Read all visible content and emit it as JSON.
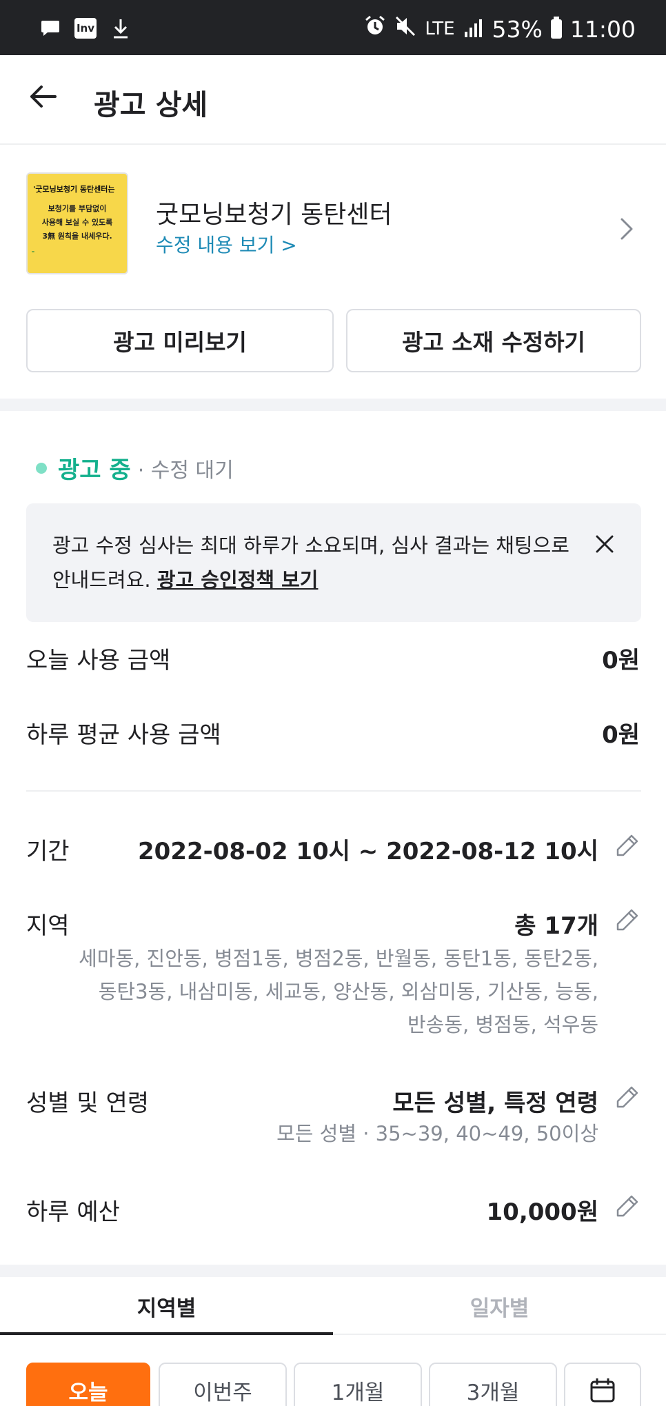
{
  "status_bar": {
    "lte": "LTE",
    "battery": "53%",
    "time": "11:00",
    "inv": "Inv"
  },
  "header": {
    "title": "광고 상세"
  },
  "ad": {
    "thumb_line1": "'굿모닝보청기 동탄센터는",
    "thumb_line2": "보청기를 부담없이",
    "thumb_line3": "사용해 보실 수 있도록",
    "thumb_line4": "3無 원칙을 내세우다.",
    "name": "굿모닝보청기 동탄센터",
    "link": "수정 내용 보기 >"
  },
  "buttons": {
    "preview": "광고 미리보기",
    "edit": "광고 소재 수정하기"
  },
  "status": {
    "main": "광고 중",
    "sub": "· 수정 대기"
  },
  "notice": {
    "text": "광고 수정 심사는 최대 하루가 소요되며, 심사 결과는 채팅으로 안내드려요. ",
    "link": "광고 승인정책 보기"
  },
  "stats": {
    "today_label": "오늘 사용 금액",
    "today_value": "0원",
    "avg_label": "하루 평균 사용 금액",
    "avg_value": "0원"
  },
  "details": {
    "period_label": "기간",
    "period_value": "2022-08-02 10시 ~ 2022-08-12 10시",
    "region_label": "지역",
    "region_value": "총 17개",
    "region_line1": "세마동, 진안동, 병점1동, 병점2동, 반월동, 동탄1동, 동탄2동,",
    "region_line2": "동탄3동, 내삼미동, 세교동, 양산동, 외삼미동, 기산동, 능동,",
    "region_line3": "반송동, 병점동, 석우동",
    "gender_label": "성별 및 연령",
    "gender_value": "모든 성별, 특정 연령",
    "gender_sub": "모든 성별 · 35~39, 40~49, 50이상",
    "budget_label": "하루 예산",
    "budget_value": "10,000원"
  },
  "tabs": {
    "region": "지역별",
    "daily": "일자별"
  },
  "chips": {
    "today": "오늘",
    "week": "이번주",
    "month1": "1개월",
    "month3": "3개월"
  },
  "colors": {
    "accent": "#ff6f0f",
    "status_green": "#14b08d",
    "link_blue": "#1d8ab5"
  }
}
